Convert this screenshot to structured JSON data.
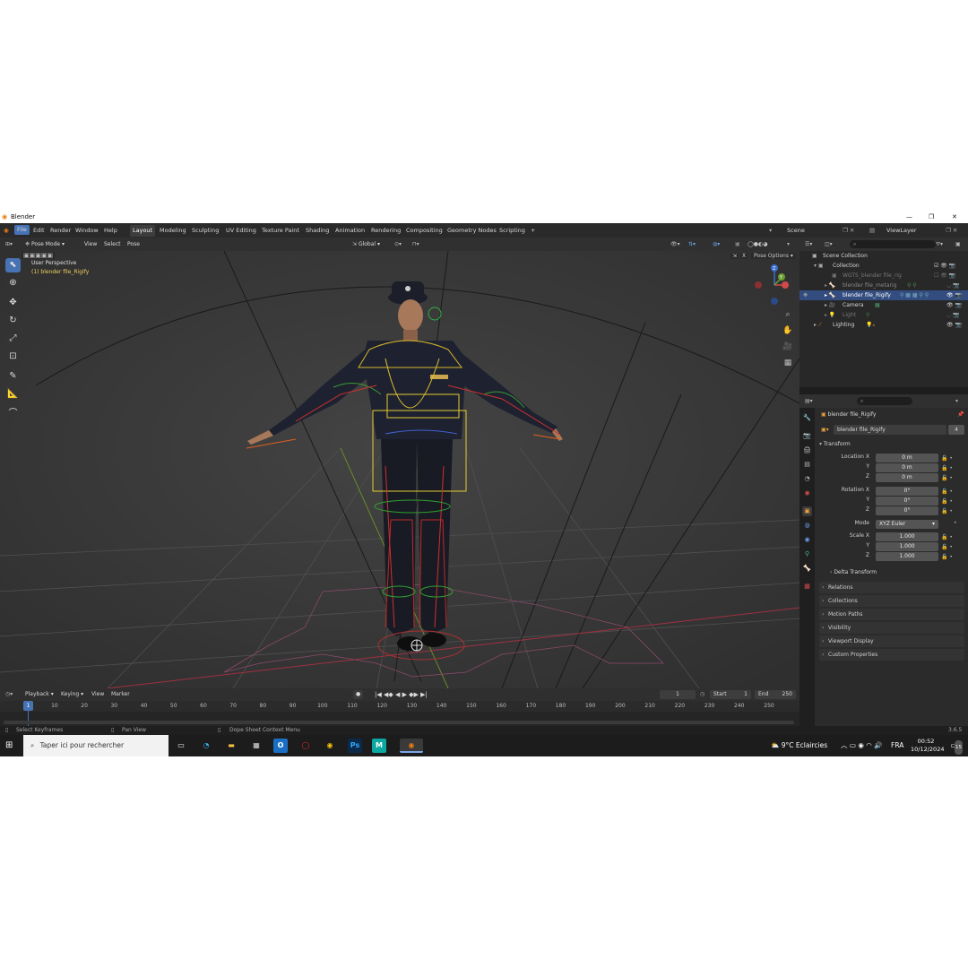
{
  "window": {
    "title": "Blender",
    "controls": [
      "—",
      "❐",
      "✕"
    ]
  },
  "menu": {
    "items": [
      "File",
      "Edit",
      "Render",
      "Window",
      "Help"
    ],
    "workspaces": [
      "Layout",
      "Modeling",
      "Sculpting",
      "UV Editing",
      "Texture Paint",
      "Shading",
      "Animation",
      "Rendering",
      "Compositing",
      "Geometry Nodes",
      "Scripting"
    ],
    "add_tab": "+",
    "scene": "Scene",
    "view_layer": "ViewLayer"
  },
  "viewport_header": {
    "mode": "Pose Mode",
    "menus": [
      "View",
      "Select",
      "Pose"
    ],
    "orientation": "Global",
    "pose_options": "Pose Options",
    "x_button": "X"
  },
  "viewport": {
    "perspective": "User Perspective",
    "object": "(1) blender file_Rigify",
    "gizmo_axes": [
      "Z",
      "Y"
    ]
  },
  "outliner": {
    "items": [
      {
        "label": "Scene Collection",
        "state": "normal"
      },
      {
        "label": "Collection",
        "state": "normal"
      },
      {
        "label": "WGTS_blender file_rig",
        "state": "dim"
      },
      {
        "label": "blender file_metarig",
        "state": "dim"
      },
      {
        "label": "blender file_Rigify",
        "state": "selected"
      },
      {
        "label": "Camera",
        "state": "normal"
      },
      {
        "label": "Light",
        "state": "dim"
      },
      {
        "label": "Lighting",
        "state": "normal"
      }
    ]
  },
  "properties": {
    "object_name": "blender file_Rigify",
    "data_name": "blender file_Rigify",
    "users": "4",
    "transform_label": "Transform",
    "location": {
      "label": "Location X",
      "x": "0 m",
      "y": "0 m",
      "z": "0 m"
    },
    "rotation": {
      "label": "Rotation X",
      "x": "0°",
      "y": "0°",
      "z": "0°"
    },
    "axis_labels": {
      "y": "Y",
      "z": "Z"
    },
    "mode_label": "Mode",
    "mode_value": "XYZ Euler",
    "scale": {
      "label": "Scale X",
      "x": "1.000",
      "y": "1.000",
      "z": "1.000"
    },
    "delta": "Delta Transform",
    "sections": [
      "Relations",
      "Collections",
      "Motion Paths",
      "Visibility",
      "Viewport Display",
      "Custom Properties"
    ]
  },
  "timeline": {
    "menus": [
      "Playback",
      "Keying",
      "View",
      "Marker"
    ],
    "current_frame": "1",
    "start_label": "Start",
    "start": "1",
    "end_label": "End",
    "end": "250",
    "ticks": [
      "1",
      "10",
      "20",
      "30",
      "40",
      "50",
      "60",
      "70",
      "80",
      "90",
      "100",
      "110",
      "120",
      "130",
      "140",
      "150",
      "160",
      "170",
      "180",
      "190",
      "200",
      "210",
      "220",
      "230",
      "240",
      "250"
    ]
  },
  "statusbar": {
    "left": "Select Keyframes",
    "middle": "Pan View",
    "right": "Dope Sheet Context Menu",
    "version": "3.6.5"
  },
  "taskbar": {
    "search_placeholder": "Taper ici pour rechercher",
    "weather": "9°C  Eclaircies",
    "language": "FRA",
    "time": "00:52",
    "date": "10/12/2024",
    "notifications": "15",
    "app_letters": {
      "photoshop": "Ps",
      "maya": "M"
    }
  }
}
